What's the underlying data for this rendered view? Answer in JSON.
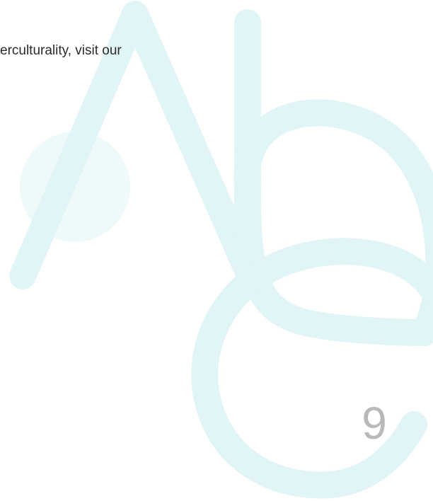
{
  "body_text": "erculturality, visit our",
  "page_number": "9",
  "colors": {
    "decor_letters": "#e1f4f6",
    "decor_circle": "#eef9fa",
    "text": "#2b2b2b",
    "page_number": "#b9b9b9"
  }
}
